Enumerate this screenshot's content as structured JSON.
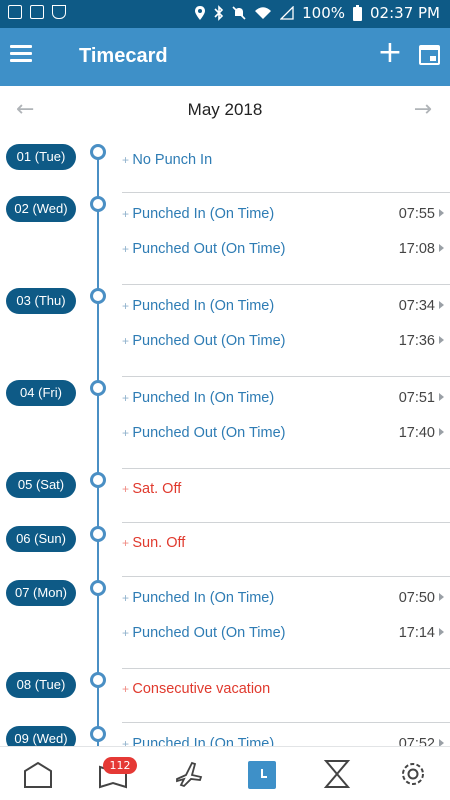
{
  "status_bar": {
    "battery": "100%",
    "time": "02:37 PM"
  },
  "app_bar": {
    "title": "Timecard",
    "icons": [
      "menu-icon",
      "plus-icon",
      "calendar-icon"
    ]
  },
  "month_nav": {
    "month": "May 2018",
    "prev_icon": "arrow-left-icon",
    "next_icon": "arrow-right-icon"
  },
  "days": [
    {
      "date": "01 (Tue)",
      "entries": [
        {
          "label": "No Punch In",
          "time": "",
          "status": "normal"
        }
      ]
    },
    {
      "date": "02 (Wed)",
      "entries": [
        {
          "label": "Punched In (On Time)",
          "time": "07:55",
          "status": "normal"
        },
        {
          "label": "Punched Out (On Time)",
          "time": "17:08",
          "status": "normal"
        }
      ]
    },
    {
      "date": "03 (Thu)",
      "entries": [
        {
          "label": "Punched In (On Time)",
          "time": "07:34",
          "status": "normal"
        },
        {
          "label": "Punched Out (On Time)",
          "time": "17:36",
          "status": "normal"
        }
      ]
    },
    {
      "date": "04 (Fri)",
      "entries": [
        {
          "label": "Punched In (On Time)",
          "time": "07:51",
          "status": "normal"
        },
        {
          "label": "Punched Out (On Time)",
          "time": "17:40",
          "status": "normal"
        }
      ]
    },
    {
      "date": "05 (Sat)",
      "entries": [
        {
          "label": "Sat. Off",
          "time": "",
          "status": "off"
        }
      ]
    },
    {
      "date": "06 (Sun)",
      "entries": [
        {
          "label": "Sun. Off",
          "time": "",
          "status": "off"
        }
      ]
    },
    {
      "date": "07 (Mon)",
      "entries": [
        {
          "label": "Punched In (On Time)",
          "time": "07:50",
          "status": "normal"
        },
        {
          "label": "Punched Out (On Time)",
          "time": "17:14",
          "status": "normal"
        }
      ]
    },
    {
      "date": "08 (Tue)",
      "entries": [
        {
          "label": "Consecutive vacation",
          "time": "",
          "status": "off"
        }
      ]
    },
    {
      "date": "09 (Wed)",
      "entries": [
        {
          "label": "Punched In (On Time)",
          "time": "07:52",
          "status": "normal"
        }
      ]
    }
  ],
  "bottom_nav": {
    "items": [
      "home-icon",
      "inbox-icon",
      "travel-icon",
      "timecard-icon",
      "hourglass-icon",
      "settings-icon"
    ],
    "badge": "112",
    "active": "timecard-icon"
  },
  "colors": {
    "status_bar": "#0e5a86",
    "app_bar": "#3e90c8",
    "pill": "#0e5a86",
    "timeline": "#4a8fc4",
    "entry_text": "#2e7cb4",
    "off_text": "#e03a2e",
    "badge": "#e53935"
  }
}
